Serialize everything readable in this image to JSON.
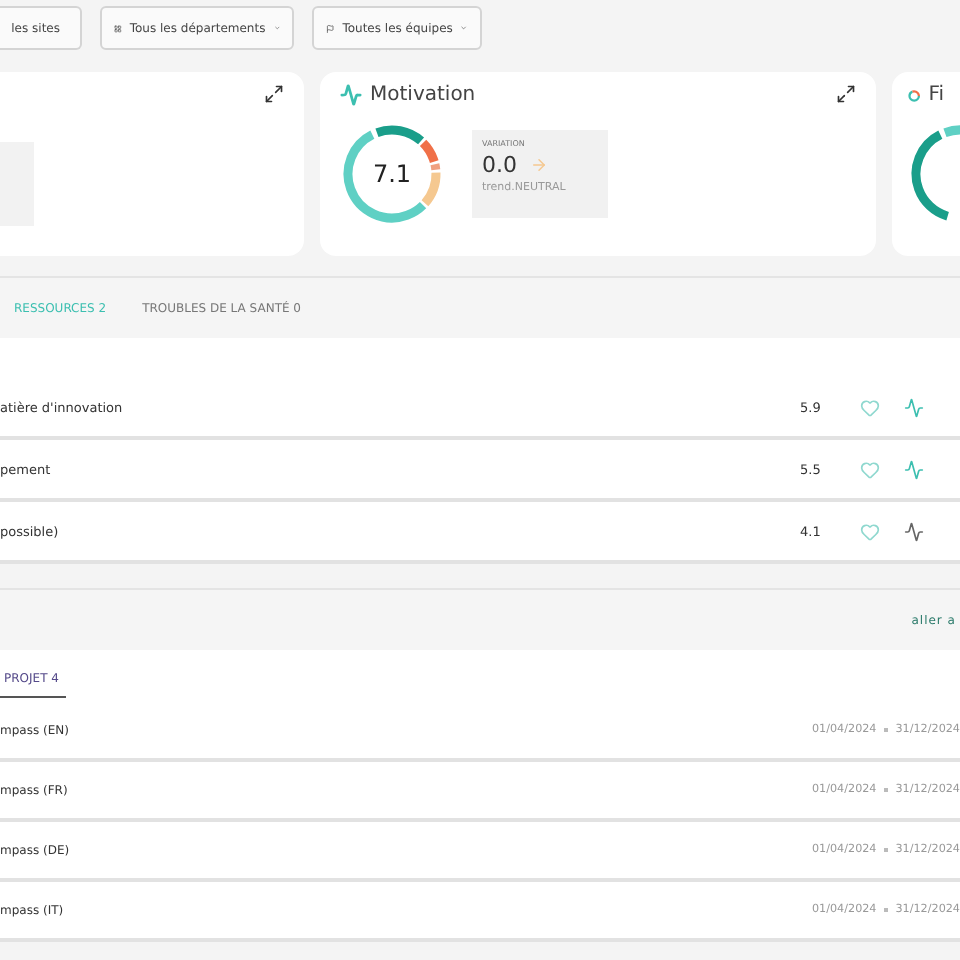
{
  "filters": [
    {
      "label": "les sites",
      "kind": "plain"
    },
    {
      "label": "Tous les départements",
      "kind": "departments"
    },
    {
      "label": "Toutes les équipes",
      "kind": "teams"
    }
  ],
  "cards": [
    {
      "kind": "clipped"
    },
    {
      "kind": "full",
      "title": "Motivation",
      "score": "7.1",
      "variation_label": "VARIATION",
      "variation": "0.0",
      "trend": "trend.NEUTRAL"
    },
    {
      "kind": "partial",
      "title": "Fi"
    }
  ],
  "resources": {
    "tabs": [
      {
        "label": "RESSOURCES 2",
        "selected": true
      },
      {
        "label": "TROUBLES DE LA SANTÉ 0",
        "selected": false
      }
    ],
    "rows": [
      {
        "name": "atière d'innovation",
        "score": "5.9",
        "highlighted": true
      },
      {
        "name": "pement",
        "score": "5.5",
        "highlighted": true
      },
      {
        "name": "possible)",
        "score": "4.1",
        "highlighted": false
      }
    ]
  },
  "projects": {
    "link": "aller a",
    "tabs": [
      {
        "label": "PROJET 4",
        "selected": true
      }
    ],
    "rows": [
      {
        "name": "mpass (EN)",
        "start": "01/04/2024",
        "end": "31/12/2024"
      },
      {
        "name": "mpass (FR)",
        "start": "01/04/2024",
        "end": "31/12/2024"
      },
      {
        "name": "mpass (DE)",
        "start": "01/04/2024",
        "end": "31/12/2024"
      },
      {
        "name": "mpass (IT)",
        "start": "01/04/2024",
        "end": "31/12/2024"
      }
    ]
  }
}
